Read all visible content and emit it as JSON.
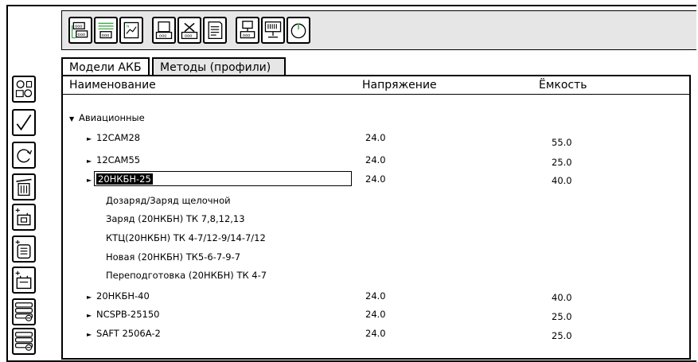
{
  "tabs": [
    {
      "label": "Модели АКБ"
    },
    {
      "label": "Методы (профили)"
    }
  ],
  "columns": [
    "Наименование",
    "Напряжение",
    "Ёмкость"
  ],
  "tree": {
    "group_label": "Авиационные",
    "rows": [
      {
        "name": "12CAM28",
        "voltage": "24.0",
        "capacity": "55.0"
      },
      {
        "name": "12CAM55",
        "voltage": "24.0",
        "capacity": "25.0"
      },
      {
        "name": "20НКБН-25",
        "voltage": "24.0",
        "capacity": "40.0"
      },
      {
        "name": "20НКБН-40",
        "voltage": "24.0",
        "capacity": "40.0"
      },
      {
        "name": "NCSPB-25150",
        "voltage": "24.0",
        "capacity": "25.0"
      },
      {
        "name": "SAFT 2506A-2",
        "voltage": "24.0",
        "capacity": "25.0"
      }
    ],
    "methods": [
      "Дозаряд/Заряд щелочной",
      "Заряд (20НКБН) ТК 7,8,12,13",
      "КТЦ(20НКБН) ТК 4-7/12-9/14-7/12",
      "Новая (20НКБН) ТК5-6-7-9-7",
      "Переподготовка (20НКБН) ТК 4-7"
    ]
  },
  "icons": {
    "toolbar": [
      "battery-charger-icon",
      "battery-list-icon",
      "chart-icon",
      "device-icon",
      "disconnect-icon",
      "document-icon",
      "network-device-icon",
      "terminal-icon",
      "power-icon"
    ],
    "sidebar": [
      "search-battery-icon",
      "check-icon",
      "refresh-icon",
      "trash-icon",
      "add-battery-icon",
      "add-list-icon",
      "add-device-icon",
      "stack-remove-icon",
      "stack-remove-icon-2"
    ]
  },
  "colors": {
    "accent_green": "#3fae4a"
  }
}
